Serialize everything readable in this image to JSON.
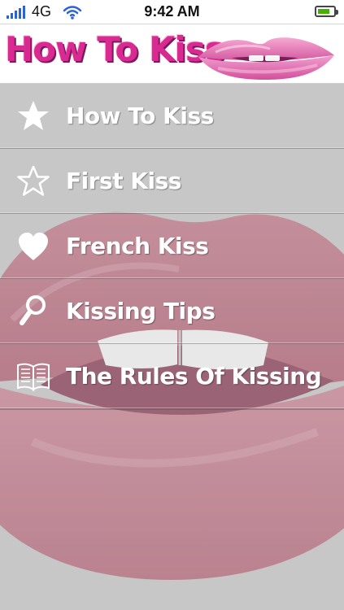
{
  "status": {
    "carrier": "4G",
    "time": "9:42 AM",
    "battery_percent": 80
  },
  "header": {
    "title": "How To Kiss",
    "title_color": "#d92a91"
  },
  "menu": {
    "items": [
      {
        "label": "How To Kiss",
        "icon": "star-filled-icon"
      },
      {
        "label": "First Kiss",
        "icon": "star-outline-icon"
      },
      {
        "label": "French Kiss",
        "icon": "heart-icon"
      },
      {
        "label": "Kissing Tips",
        "icon": "magnifier-icon"
      },
      {
        "label": "The Rules Of Kissing",
        "icon": "book-icon"
      }
    ]
  },
  "colors": {
    "content_background": "#c7c7c7",
    "menu_text": "#ffffff",
    "signal": "#2a63d7",
    "battery": "#46b000"
  }
}
